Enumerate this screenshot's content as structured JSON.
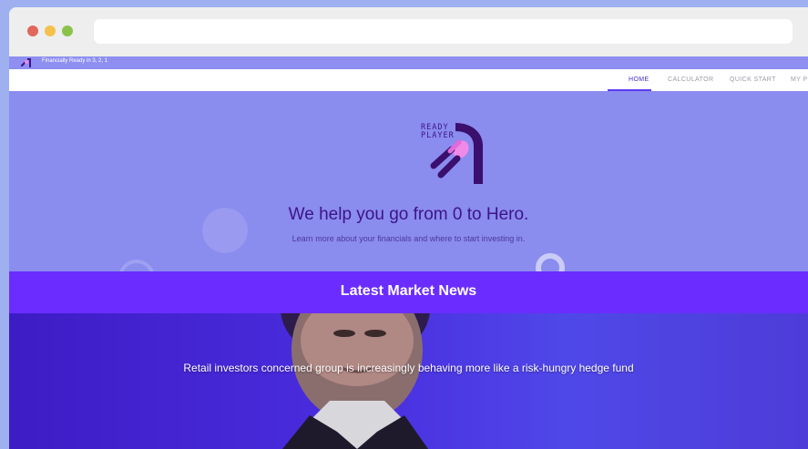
{
  "site": {
    "tagline": "Financially Ready in 3, 2, 1"
  },
  "nav": {
    "items": [
      {
        "label": "HOME",
        "active": true
      },
      {
        "label": "CALCULATOR",
        "active": false
      },
      {
        "label": "QUICK START",
        "active": false
      },
      {
        "label": "MY P",
        "active": false
      }
    ]
  },
  "hero": {
    "logo_text_line1": "READY",
    "logo_text_line2": "PLAYER",
    "title": "We help you go from 0 to Hero.",
    "subtitle": "Learn more about your financials and where to start investing in."
  },
  "news": {
    "section_title": "Latest Market News",
    "headline": "Retail investors concerned group is increasingly behaving more like a risk-hungry hedge fund"
  },
  "colors": {
    "accent": "#6b2dff",
    "hero_bg": "#8a8cee",
    "title": "#3d1488"
  }
}
